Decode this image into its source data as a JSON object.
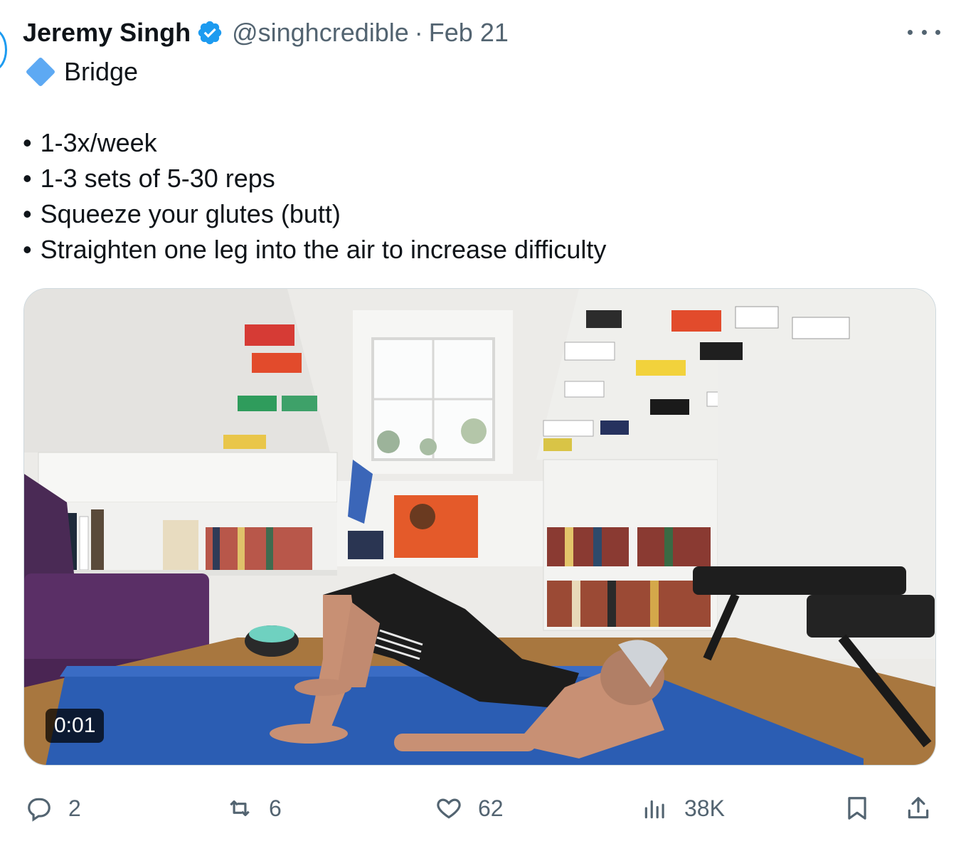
{
  "author": {
    "name": "Jeremy Singh",
    "handle": "@singhcredible",
    "separator": "·",
    "date": "Feb 21"
  },
  "post": {
    "title": "Bridge",
    "bullets": [
      "1-3x/week",
      "1-3 sets of 5-30 reps",
      "Squeeze your glutes (butt)",
      "Straighten one leg into the air to increase difficulty"
    ]
  },
  "video": {
    "timestamp": "0:01"
  },
  "actions": {
    "replies": "2",
    "reposts": "6",
    "likes": "62",
    "views": "38K"
  },
  "colors": {
    "accent": "#1d9bf0",
    "muted": "#536471",
    "text": "#0f1419"
  },
  "icons": [
    "verified-badge-icon",
    "more-options-icon",
    "diamond-icon",
    "reply-icon",
    "repost-icon",
    "like-icon",
    "views-icon",
    "bookmark-icon",
    "share-icon"
  ]
}
